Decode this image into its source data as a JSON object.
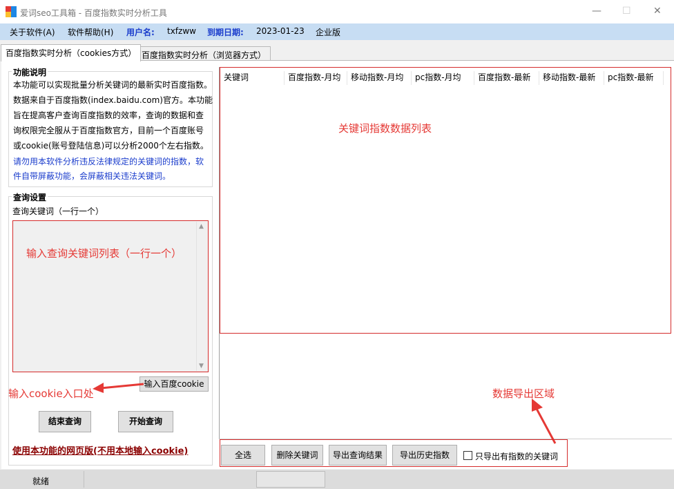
{
  "window": {
    "title": "爱词seo工具箱 - 百度指数实时分析工具",
    "minimize_glyph": "—",
    "maximize_glyph": "☐",
    "close_glyph": "✕"
  },
  "menu": {
    "about": "关于软件(A)",
    "help": "软件帮助(H)",
    "username_label": "用户名:",
    "username_value": "txfzww",
    "expiry_label": "到期日期:",
    "expiry_value": "2023-01-23",
    "edition": "企业版"
  },
  "tabs": [
    {
      "label": "百度指数实时分析（cookies方式）"
    },
    {
      "label": "百度指数实时分析（浏览器方式）"
    }
  ],
  "function_desc": {
    "title": "功能说明",
    "lines": [
      "本功能可以实现批量分析关键词的最新实时百度指数。",
      "数据来自于百度指数(index.baidu.com)官方。本功能",
      "旨在提高客户查询百度指数的效率，查询的数据和查",
      "询权限完全服从于百度指数官方，目前一个百度账号",
      "或cookie(账号登陆信息)可以分析2000个左右指数。"
    ],
    "warning_lines": [
      "请勿用本软件分析违反法律规定的关键词的指数，软",
      "件自带屏蔽功能，会屏蔽相关违法关键词。"
    ]
  },
  "query_settings": {
    "title": "查询设置",
    "keyword_label": "查询关键词（一行一个）",
    "cookie_button": "输入百度cookie",
    "end_button": "结束查询",
    "start_button": "开始查询",
    "web_link": "使用本功能的网页版(不用本地输入cookie)"
  },
  "annotations": {
    "textarea_hint": "输入查询关键词列表（一行一个）",
    "cookie_hint": "输入cookie入口处",
    "list_hint": "关键词指数数据列表",
    "export_hint": "数据导出区域"
  },
  "table": {
    "columns": [
      "关键词",
      "百度指数-月均",
      "移动指数-月均",
      "pc指数-月均",
      "百度指数-最新",
      "移动指数-最新",
      "pc指数-最新"
    ]
  },
  "actions": {
    "select_all": "全选",
    "delete_keywords": "删除关键词",
    "export_results": "导出查询结果",
    "export_history": "导出历史指数",
    "only_with_index": "只导出有指数的关键词"
  },
  "status": {
    "text": "就绪"
  },
  "colors": {
    "menubar": "#c7ddf3",
    "accent_blue": "#1a3ccc",
    "annotation_red": "#e53935",
    "link_dark_red": "#8b0000"
  }
}
